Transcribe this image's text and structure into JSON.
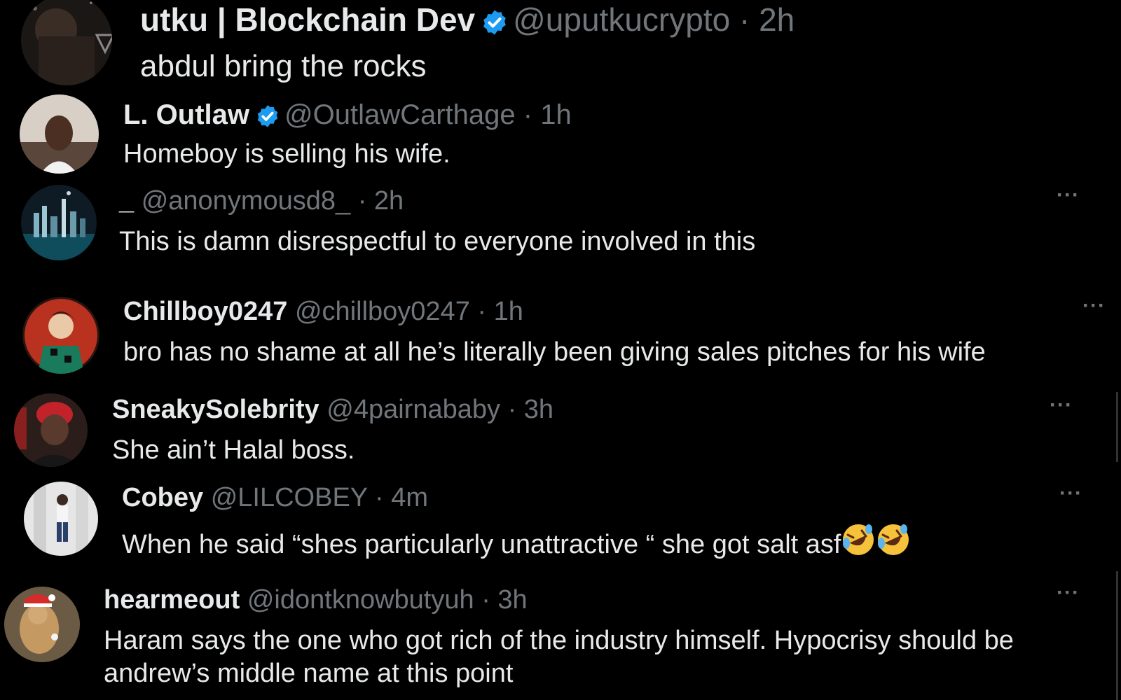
{
  "replies": [
    {
      "name": "utku | Blockchain Dev",
      "verified": true,
      "handle": "@uputkucrypto",
      "separator": "·",
      "time": "2h",
      "text": "abdul bring the rocks",
      "more_label": ""
    },
    {
      "name": "L. Outlaw",
      "verified": true,
      "handle": "@OutlawCarthage",
      "separator": "·",
      "time": "1h",
      "text": "Homeboy is selling his wife.",
      "more_label": ""
    },
    {
      "name": "_",
      "verified": false,
      "handle": "@anonymousd8_",
      "separator": "·",
      "time": "2h",
      "text": "This is damn disrespectful to everyone involved in this",
      "more_label": "···"
    },
    {
      "name": "Chillboy0247",
      "verified": false,
      "handle": "@chillboy0247",
      "separator": "·",
      "time": "1h",
      "text": "bro has no shame at all he’s literally been giving sales pitches for his wife",
      "more_label": "···"
    },
    {
      "name": "SneakySolebrity",
      "verified": false,
      "handle": "@4pairnababy",
      "separator": "·",
      "time": "3h",
      "text": "She ain’t Halal boss.",
      "more_label": "···"
    },
    {
      "name": "Cobey",
      "verified": false,
      "handle": "@LILCOBEY",
      "separator": "·",
      "time": "4m",
      "text": "When he said “shes particularly unattractive “ she got salt asf",
      "text_emoji": "rolling-on-floor-laughing-icon x2",
      "more_label": "···"
    },
    {
      "name": "hearmeout",
      "verified": false,
      "handle": "@idontknowbutyuh",
      "separator": "·",
      "time": "3h",
      "text": "Haram says the one who got rich of the industry himself. Hypocrisy should be andrew’s middle name at this point",
      "more_label": "···"
    }
  ],
  "colors": {
    "background": "#000000",
    "primary_text": "#e7e9ea",
    "secondary_text": "#71767b",
    "verified_badge": "#1d9bf0"
  }
}
